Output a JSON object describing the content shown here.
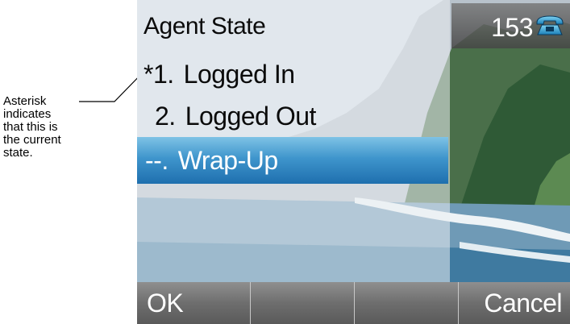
{
  "screen": {
    "title": "Agent State",
    "line_number": "153",
    "phone_icon": "phone-handset-icon",
    "menu_items": [
      {
        "prefix": "*1.",
        "label": "Logged In",
        "current": true,
        "selected": false
      },
      {
        "prefix": "2.",
        "label": "Logged Out",
        "current": false,
        "selected": false
      },
      {
        "prefix": "--.",
        "label": "Wrap-Up",
        "current": false,
        "selected": true
      }
    ],
    "softkeys": [
      "OK",
      "",
      "",
      "Cancel"
    ]
  },
  "annotation": {
    "text": "Asterisk\nindicates\nthat this is\nthe current\nstate."
  },
  "colors": {
    "selection": "#3f95cc",
    "softkey_bar": "#6e6e6e",
    "status_box": "#5a5a5a"
  }
}
